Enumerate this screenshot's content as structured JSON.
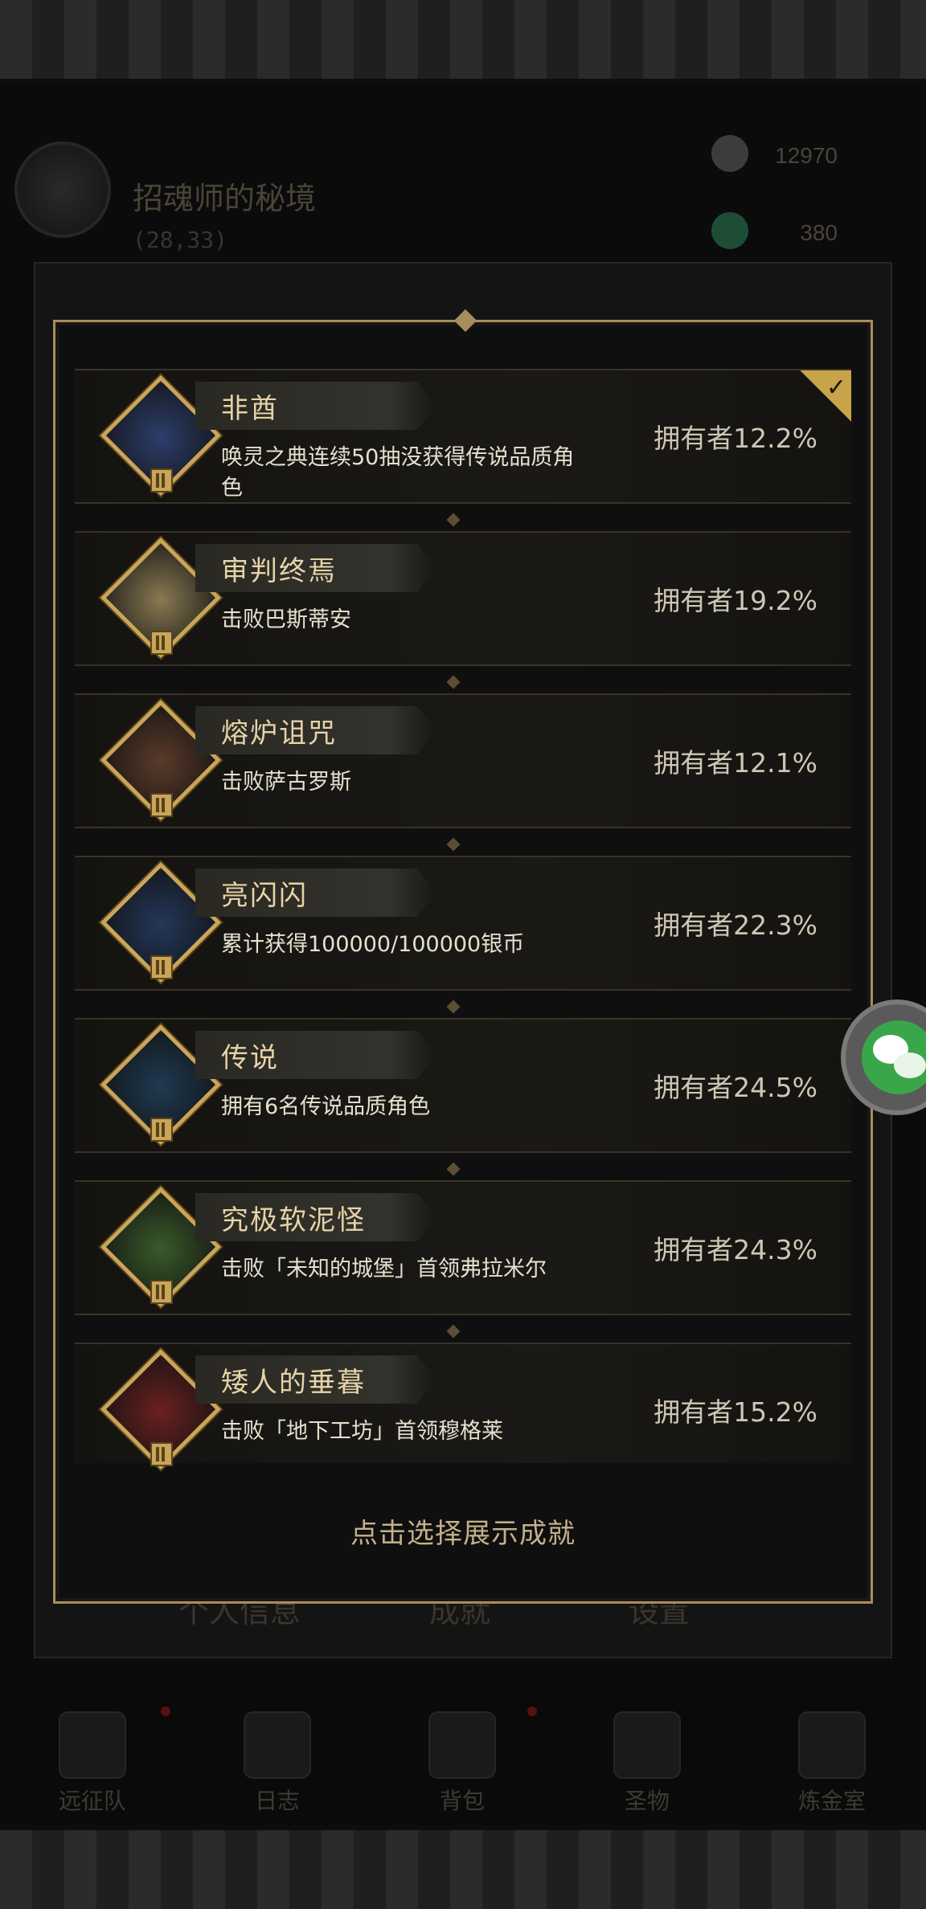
{
  "background": {
    "title": "招魂师的秘境",
    "coord": "(28,33)",
    "resources": [
      {
        "icon": "stone-icon",
        "value": "12970"
      },
      {
        "icon": "gem-icon",
        "value": "380"
      }
    ],
    "tabs": [
      "个人信息",
      "成就",
      "设置"
    ],
    "nav": [
      {
        "icon": "expedition-icon",
        "label": "远征队"
      },
      {
        "icon": "journal-icon",
        "label": "日志"
      },
      {
        "icon": "bag-icon",
        "label": "背包"
      },
      {
        "icon": "relic-icon",
        "label": "圣物"
      },
      {
        "icon": "alchemy-icon",
        "label": "炼金室"
      }
    ]
  },
  "achievements": [
    {
      "name": "非酋",
      "desc": "唤灵之典连续50抽没获得传说品质角色",
      "owner": "拥有者12.2%",
      "selected": true,
      "icon": "centaur-knight-icon",
      "color": "#2c3e6b"
    },
    {
      "name": "审判终焉",
      "desc": "击败巴斯蒂安",
      "owner": "拥有者19.2%",
      "selected": false,
      "icon": "bishop-icon",
      "color": "#8a7a52"
    },
    {
      "name": "熔炉诅咒",
      "desc": "击败萨古罗斯",
      "owner": "拥有者12.1%",
      "selected": false,
      "icon": "forge-demon-icon",
      "color": "#5b3a2a"
    },
    {
      "name": "亮闪闪",
      "desc": "累计获得100000/100000银币",
      "owner": "拥有者22.3%",
      "selected": false,
      "icon": "silver-coins-icon",
      "color": "#24375a"
    },
    {
      "name": "传说",
      "desc": "拥有6名传说品质角色",
      "owner": "拥有者24.5%",
      "selected": false,
      "icon": "legend-hero-icon",
      "color": "#1f3a52"
    },
    {
      "name": "究极软泥怪",
      "desc": "击败「未知的城堡」首领弗拉米尔",
      "owner": "拥有者24.3%",
      "selected": false,
      "icon": "slime-boss-icon",
      "color": "#3a5a2a"
    },
    {
      "name": "矮人的垂暮",
      "desc": "击败「地下工坊」首领穆格莱",
      "owner": "拥有者15.2%",
      "selected": false,
      "icon": "dwarf-king-icon",
      "color": "#6a2020"
    }
  ],
  "footer_hint": "点击选择展示成就",
  "wechat": {
    "icon": "wechat-icon"
  }
}
